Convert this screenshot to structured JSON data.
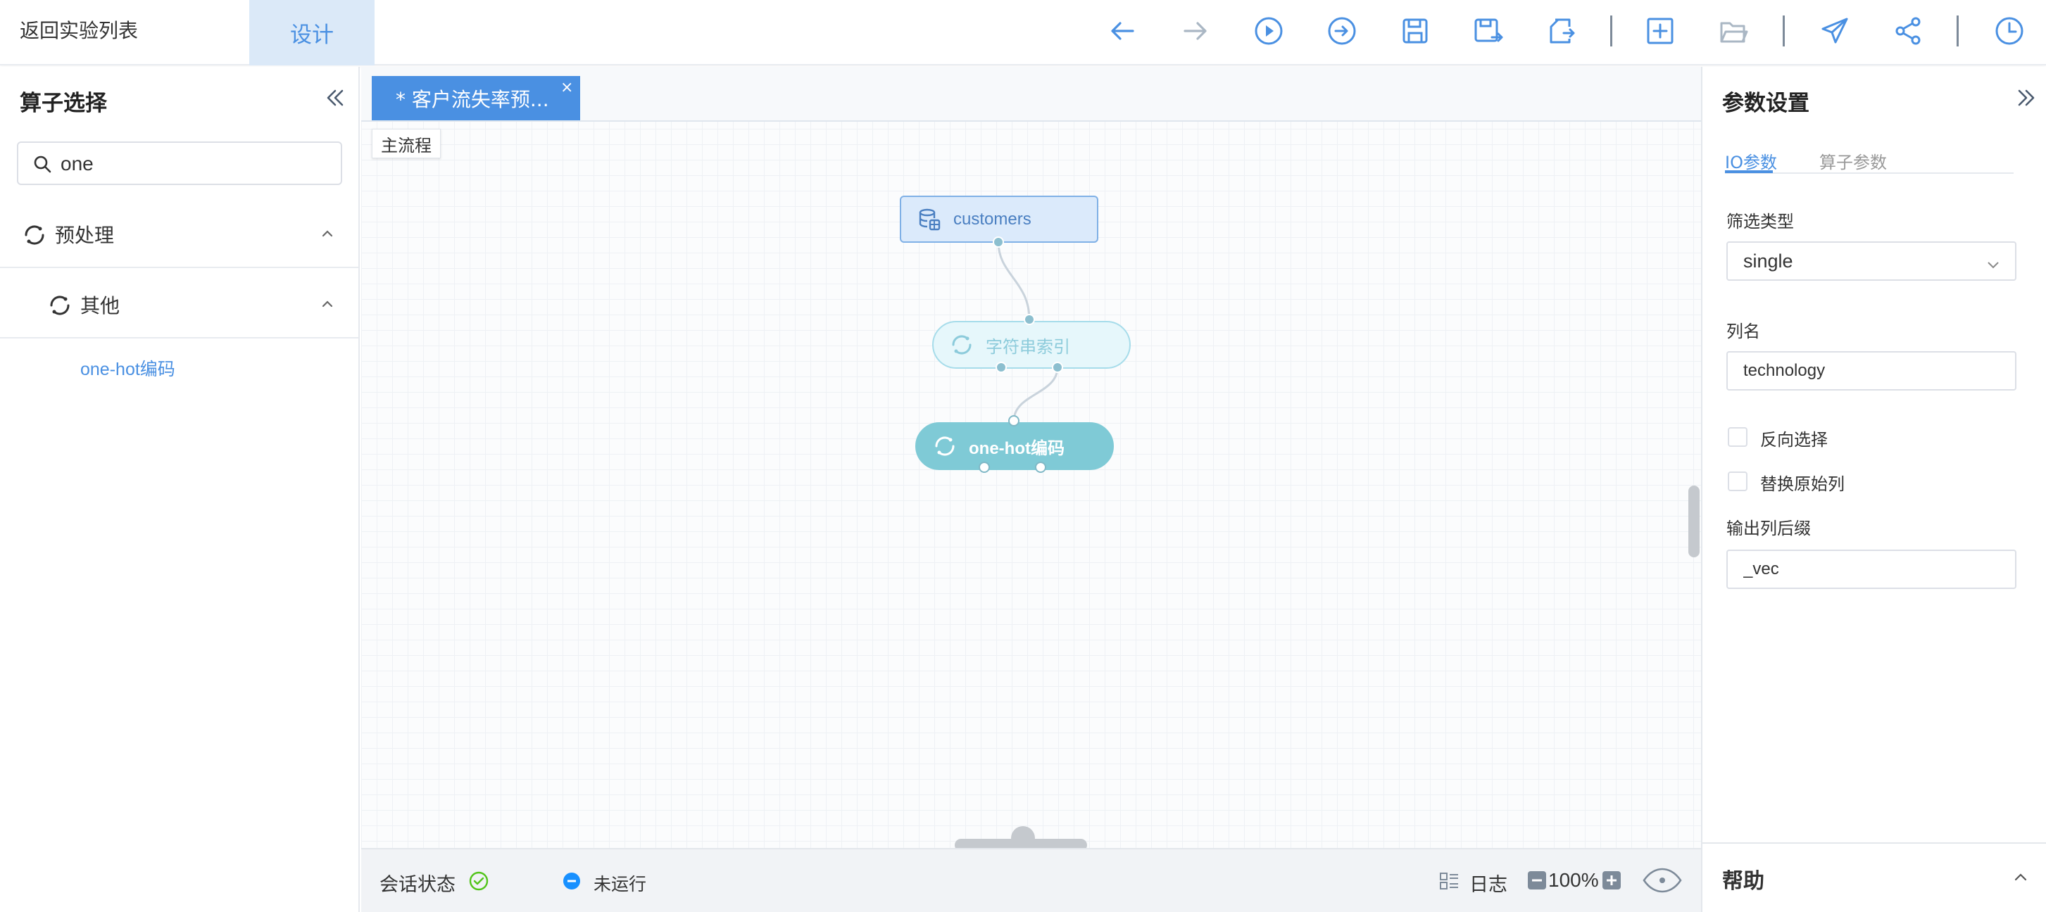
{
  "topbar": {
    "back_label": "返回实验列表",
    "design_tab_label": "设计",
    "icons": [
      "undo-arrow-icon",
      "redo-arrow-icon",
      "run-icon",
      "run-from-here-icon",
      "save-icon",
      "save-as-icon",
      "export-icon",
      "new-icon",
      "open-folder-icon",
      "publish-icon",
      "share-icon",
      "history-clock-icon"
    ]
  },
  "left_panel": {
    "title": "算子选择",
    "search": {
      "value": "one",
      "placeholder": ""
    },
    "tree": {
      "category_label": "预处理",
      "subcategory_label": "其他",
      "leaf_label": "one-hot编码"
    }
  },
  "canvas": {
    "doc_tab_label": "* 客户流失率预...",
    "doc_tab_close": "×",
    "main_flow_label": "主流程",
    "nodes": {
      "customers": "customers",
      "string_index": "字符串索引",
      "one_hot": "one-hot编码"
    }
  },
  "statusbar": {
    "session_label": "会话状态",
    "run_status": "未运行",
    "log_label": "日志",
    "zoom": "100%"
  },
  "right_panel": {
    "title": "参数设置",
    "tabs": {
      "io": "IO参数",
      "operator": "算子参数"
    },
    "filter_type_label": "筛选类型",
    "filter_type_value": "single",
    "column_name_label": "列名",
    "column_name_value": "technology",
    "reverse_select_label": "反向选择",
    "replace_original_label": "替换原始列",
    "output_suffix_label": "输出列后缀",
    "output_suffix_value": "_vec",
    "help_label": "帮助"
  },
  "colors": {
    "accent": "#4a90e2",
    "node_source_bg": "#dbeafb",
    "node_indexer_bg": "#e6f7fb",
    "node_active_bg": "#7fcad6",
    "success": "#52c41a"
  }
}
